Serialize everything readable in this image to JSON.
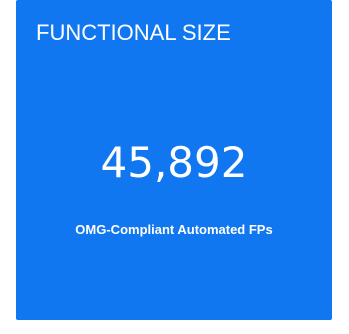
{
  "tile": {
    "title": "FUNCTIONAL SIZE",
    "value": "45,892",
    "caption": "OMG-Compliant Automated FPs",
    "background_color": "#1077f0",
    "text_color": "#ffffff"
  }
}
